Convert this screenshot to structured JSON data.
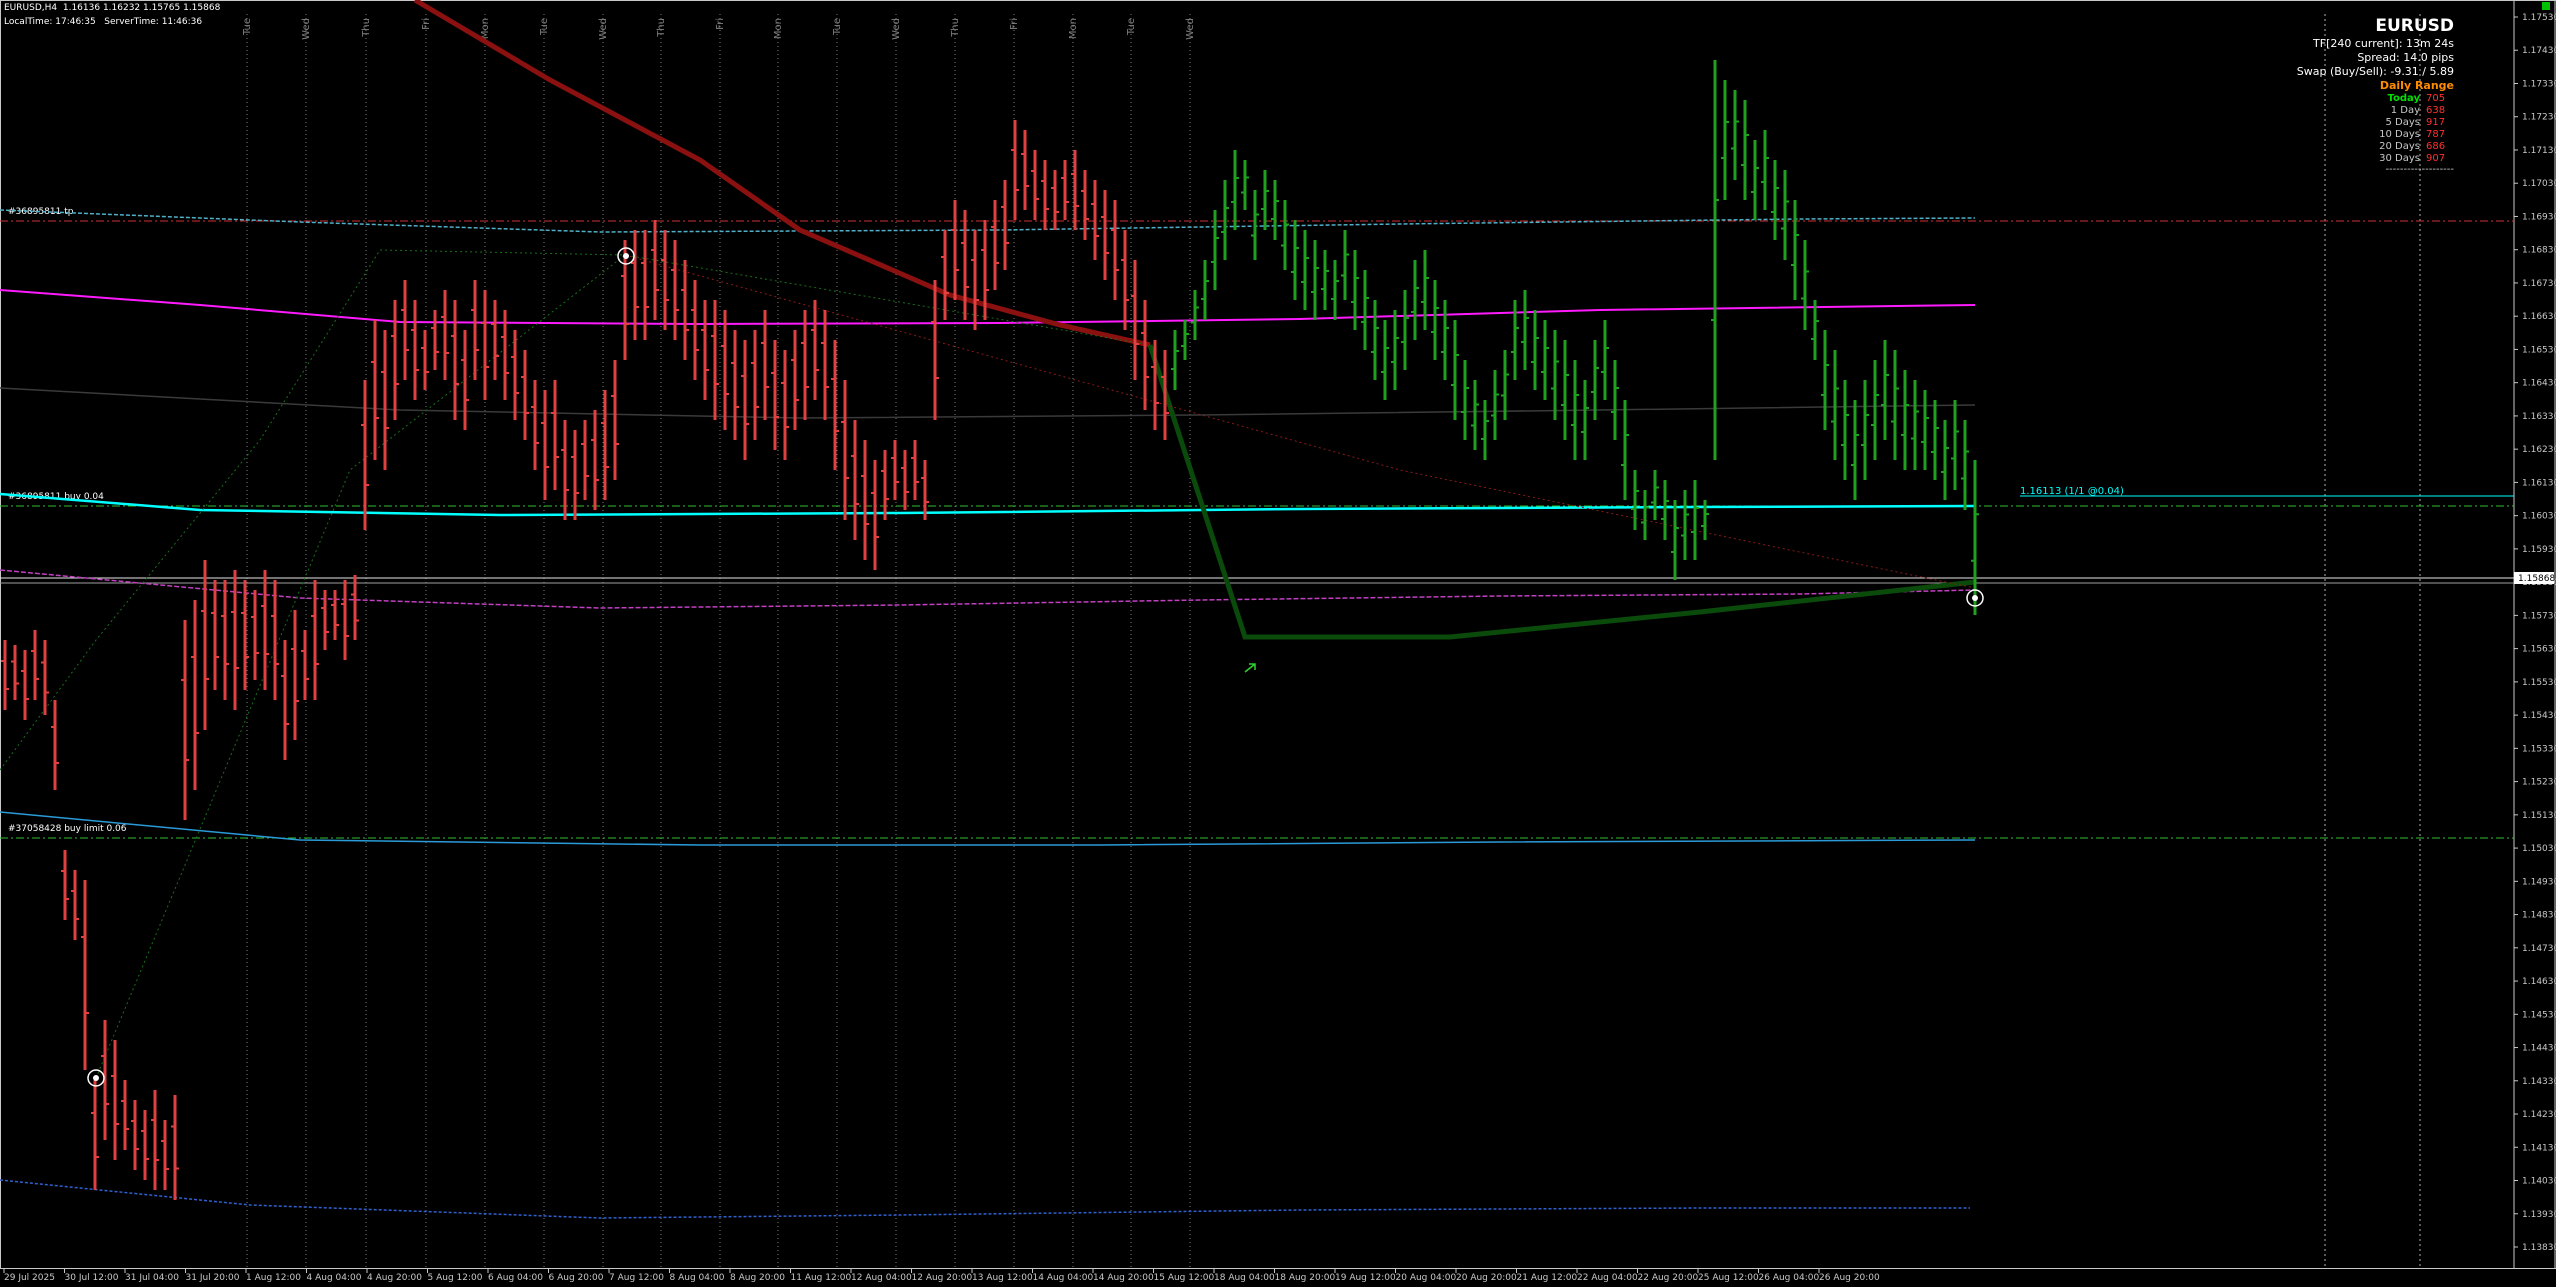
{
  "header": {
    "symbol_tf": "EURUSD,H4",
    "ohlc": "1.16136 1.16232 1.15765 1.15868",
    "local_time": "LocalTime: 17:46:35",
    "server_time": "ServerTime: 11:46:36"
  },
  "info_panel": {
    "symbol": "EURUSD",
    "tf_line": "TF[240 current]: 13m 24s",
    "spread_line": "Spread: 14.0 pips",
    "swap_line": "Swap (Buy/Sell): -9.31 / 5.89",
    "daily_range_title": "Daily Range",
    "ranges": [
      {
        "label": "Today",
        "value": "705"
      },
      {
        "label": "1 Day",
        "value": "638"
      },
      {
        "label": "5 Days",
        "value": "917"
      },
      {
        "label": "10 Days",
        "value": "787"
      },
      {
        "label": "20 Days",
        "value": "686"
      },
      {
        "label": "30 Days",
        "value": "907"
      }
    ],
    "separator": "-------------------"
  },
  "order_labels": {
    "tp": "#36895811 tp",
    "buy": "#36895811 buy 0.04",
    "buy_limit": "#37058428 buy limit 0.06",
    "position": "1.16113 (1/1 @0.04)"
  },
  "current_price_label": "1.15868",
  "day_labels": [
    "Tue",
    "Wed",
    "Thu",
    "Fri",
    "Mon",
    "Tue",
    "Wed",
    "Thu",
    "Fri",
    "Mon",
    "Tue",
    "Wed",
    "Thu",
    "Fri",
    "Mon",
    "Tue",
    "Wed"
  ],
  "colors": {
    "bear_bar": "#e04040",
    "bull_bar": "#1fa01f",
    "ma_magenta": "#ff1aff",
    "cyan": "#00ffff",
    "blue_line": "#2a9bd8",
    "dark_red_ma": "#8b1010",
    "dark_green_ma": "#0a4a0a",
    "grid_dot": "#b0b0b0",
    "level_red": "#d03030",
    "level_green": "#30c030"
  },
  "chart_data": {
    "type": "ohlc",
    "y_axis_ticks": [
      "1.17530",
      "1.17430",
      "1.17330",
      "1.17230",
      "1.17130",
      "1.17030",
      "1.16930",
      "1.16830",
      "1.16730",
      "1.16630",
      "1.16530",
      "1.16430",
      "1.16330",
      "1.16230",
      "1.16130",
      "1.16030",
      "1.15930",
      "1.15830",
      "1.15730",
      "1.15630",
      "1.15530",
      "1.15430",
      "1.15330",
      "1.15230",
      "1.15130",
      "1.15030",
      "1.14930",
      "1.14830",
      "1.14730",
      "1.14630",
      "1.14530",
      "1.14430",
      "1.14330",
      "1.14230",
      "1.14130",
      "1.14030",
      "1.13930",
      "1.13830"
    ],
    "ylim": [
      1.1376,
      1.1754
    ],
    "x_axis_ticks": [
      "29 Jul 2025",
      "30 Jul 12:00",
      "31 Jul 04:00",
      "31 Jul 20:00",
      "1 Aug 12:00",
      "4 Aug 04:00",
      "4 Aug 20:00",
      "5 Aug 12:00",
      "6 Aug 04:00",
      "6 Aug 20:00",
      "7 Aug 12:00",
      "8 Aug 04:00",
      "8 Aug 20:00",
      "11 Aug 12:00",
      "12 Aug 04:00",
      "12 Aug 20:00",
      "13 Aug 12:00",
      "14 Aug 04:00",
      "14 Aug 20:00",
      "15 Aug 12:00",
      "18 Aug 04:00",
      "18 Aug 20:00",
      "19 Aug 12:00",
      "20 Aug 04:00",
      "20 Aug 20:00",
      "21 Aug 12:00",
      "22 Aug 04:00",
      "22 Aug 20:00",
      "25 Aug 12:00",
      "26 Aug 04:00",
      "26 Aug 20:00"
    ],
    "bars_bear": [
      [
        1.1525,
        1.151
      ],
      [
        1.1515,
        1.15
      ],
      [
        1.153,
        1.1495
      ],
      [
        1.152,
        1.1485
      ],
      [
        1.156,
        1.1515
      ],
      [
        1.1505,
        1.1485
      ],
      [
        1.1455,
        1.143
      ],
      [
        1.1385,
        1.14
      ],
      [
        1.1425,
        1.1415
      ],
      [
        1.144,
        1.1375
      ],
      [
        1.146,
        1.143
      ],
      [
        1.1445,
        1.141
      ],
      [
        1.143,
        1.14
      ],
      [
        1.1415,
        1.138
      ],
      [
        1.1405,
        1.138
      ],
      [
        1.14,
        1.138
      ],
      [
        1.139,
        1.139
      ],
      [
        1.1585,
        1.1585
      ],
      [
        1.158,
        1.157
      ],
      [
        1.157,
        1.1545
      ],
      [
        1.159,
        1.157
      ],
      [
        1.1575,
        1.156
      ],
      [
        1.159,
        1.157
      ],
      [
        1.158,
        1.156
      ],
      [
        1.157,
        1.155
      ],
      [
        1.1565,
        1.1545
      ],
      [
        1.1545,
        1.1515
      ],
      [
        1.1545,
        1.152
      ],
      [
        1.1565,
        1.155
      ],
      [
        1.158,
        1.156
      ],
      [
        1.1595,
        1.1575
      ],
      [
        1.159,
        1.1585
      ],
      [
        1.1585,
        1.157
      ],
      [
        1.1665,
        1.165
      ],
      [
        1.166,
        1.1645
      ],
      [
        1.168,
        1.166
      ],
      [
        1.1675,
        1.1655
      ],
      [
        1.1675,
        1.165
      ],
      [
        1.1665,
        1.1645
      ],
      [
        1.166,
        1.1645
      ],
      [
        1.165,
        1.1635
      ],
      [
        1.1645,
        1.164
      ],
      [
        1.1665,
        1.1645
      ],
      [
        1.1655,
        1.165
      ],
      [
        1.1665,
        1.165
      ],
      [
        1.1625,
        1.1605
      ],
      [
        1.162,
        1.1605
      ],
      [
        1.161,
        1.16
      ],
      [
        1.1615,
        1.16
      ],
      [
        1.162,
        1.1605
      ],
      [
        1.162,
        1.16
      ],
      [
        1.1625,
        1.161
      ],
      [
        1.169,
        1.1675
      ],
      [
        1.17,
        1.168
      ],
      [
        1.1705,
        1.1695
      ],
      [
        1.1715,
        1.17
      ],
      [
        1.171,
        1.1705
      ],
      [
        1.1705,
        1.17
      ],
      [
        1.17,
        1.169
      ],
      [
        1.169,
        1.167
      ],
      [
        1.168,
        1.166
      ],
      [
        1.166,
        1.1645
      ],
      [
        1.165,
        1.1635
      ]
    ],
    "bars_bull": [
      [
        1.1645,
        1.1655
      ],
      [
        1.165,
        1.166
      ],
      [
        1.1665,
        1.168
      ],
      [
        1.1685,
        1.1695
      ],
      [
        1.17,
        1.171
      ],
      [
        1.17,
        1.1715
      ],
      [
        1.1705,
        1.171
      ],
      [
        1.17,
        1.1705
      ],
      [
        1.169,
        1.168
      ],
      [
        1.167,
        1.168
      ],
      [
        1.167,
        1.1665
      ],
      [
        1.168,
        1.169
      ],
      [
        1.1675,
        1.1665
      ],
      [
        1.1665,
        1.165
      ],
      [
        1.165,
        1.164
      ],
      [
        1.1645,
        1.1655
      ],
      [
        1.166,
        1.1665
      ],
      [
        1.1655,
        1.1665
      ],
      [
        1.165,
        1.166
      ],
      [
        1.164,
        1.165
      ],
      [
        1.163,
        1.164
      ],
      [
        1.162,
        1.163
      ],
      [
        1.161,
        1.16
      ],
      [
        1.1595,
        1.161
      ],
      [
        1.16,
        1.161
      ],
      [
        1.161,
        1.162
      ],
      [
        1.166,
        1.17
      ],
      [
        1.172,
        1.171
      ],
      [
        1.171,
        1.17
      ],
      [
        1.171,
        1.1705
      ],
      [
        1.169,
        1.17
      ],
      [
        1.166,
        1.165
      ],
      [
        1.163,
        1.162
      ],
      [
        1.162,
        1.161
      ],
      [
        1.163,
        1.1625
      ],
      [
        1.1625,
        1.1635
      ],
      [
        1.163,
        1.164
      ],
      [
        1.164,
        1.165
      ],
      [
        1.1625,
        1.162
      ],
      [
        1.161,
        1.16
      ],
      [
        1.16,
        1.159
      ]
    ]
  }
}
